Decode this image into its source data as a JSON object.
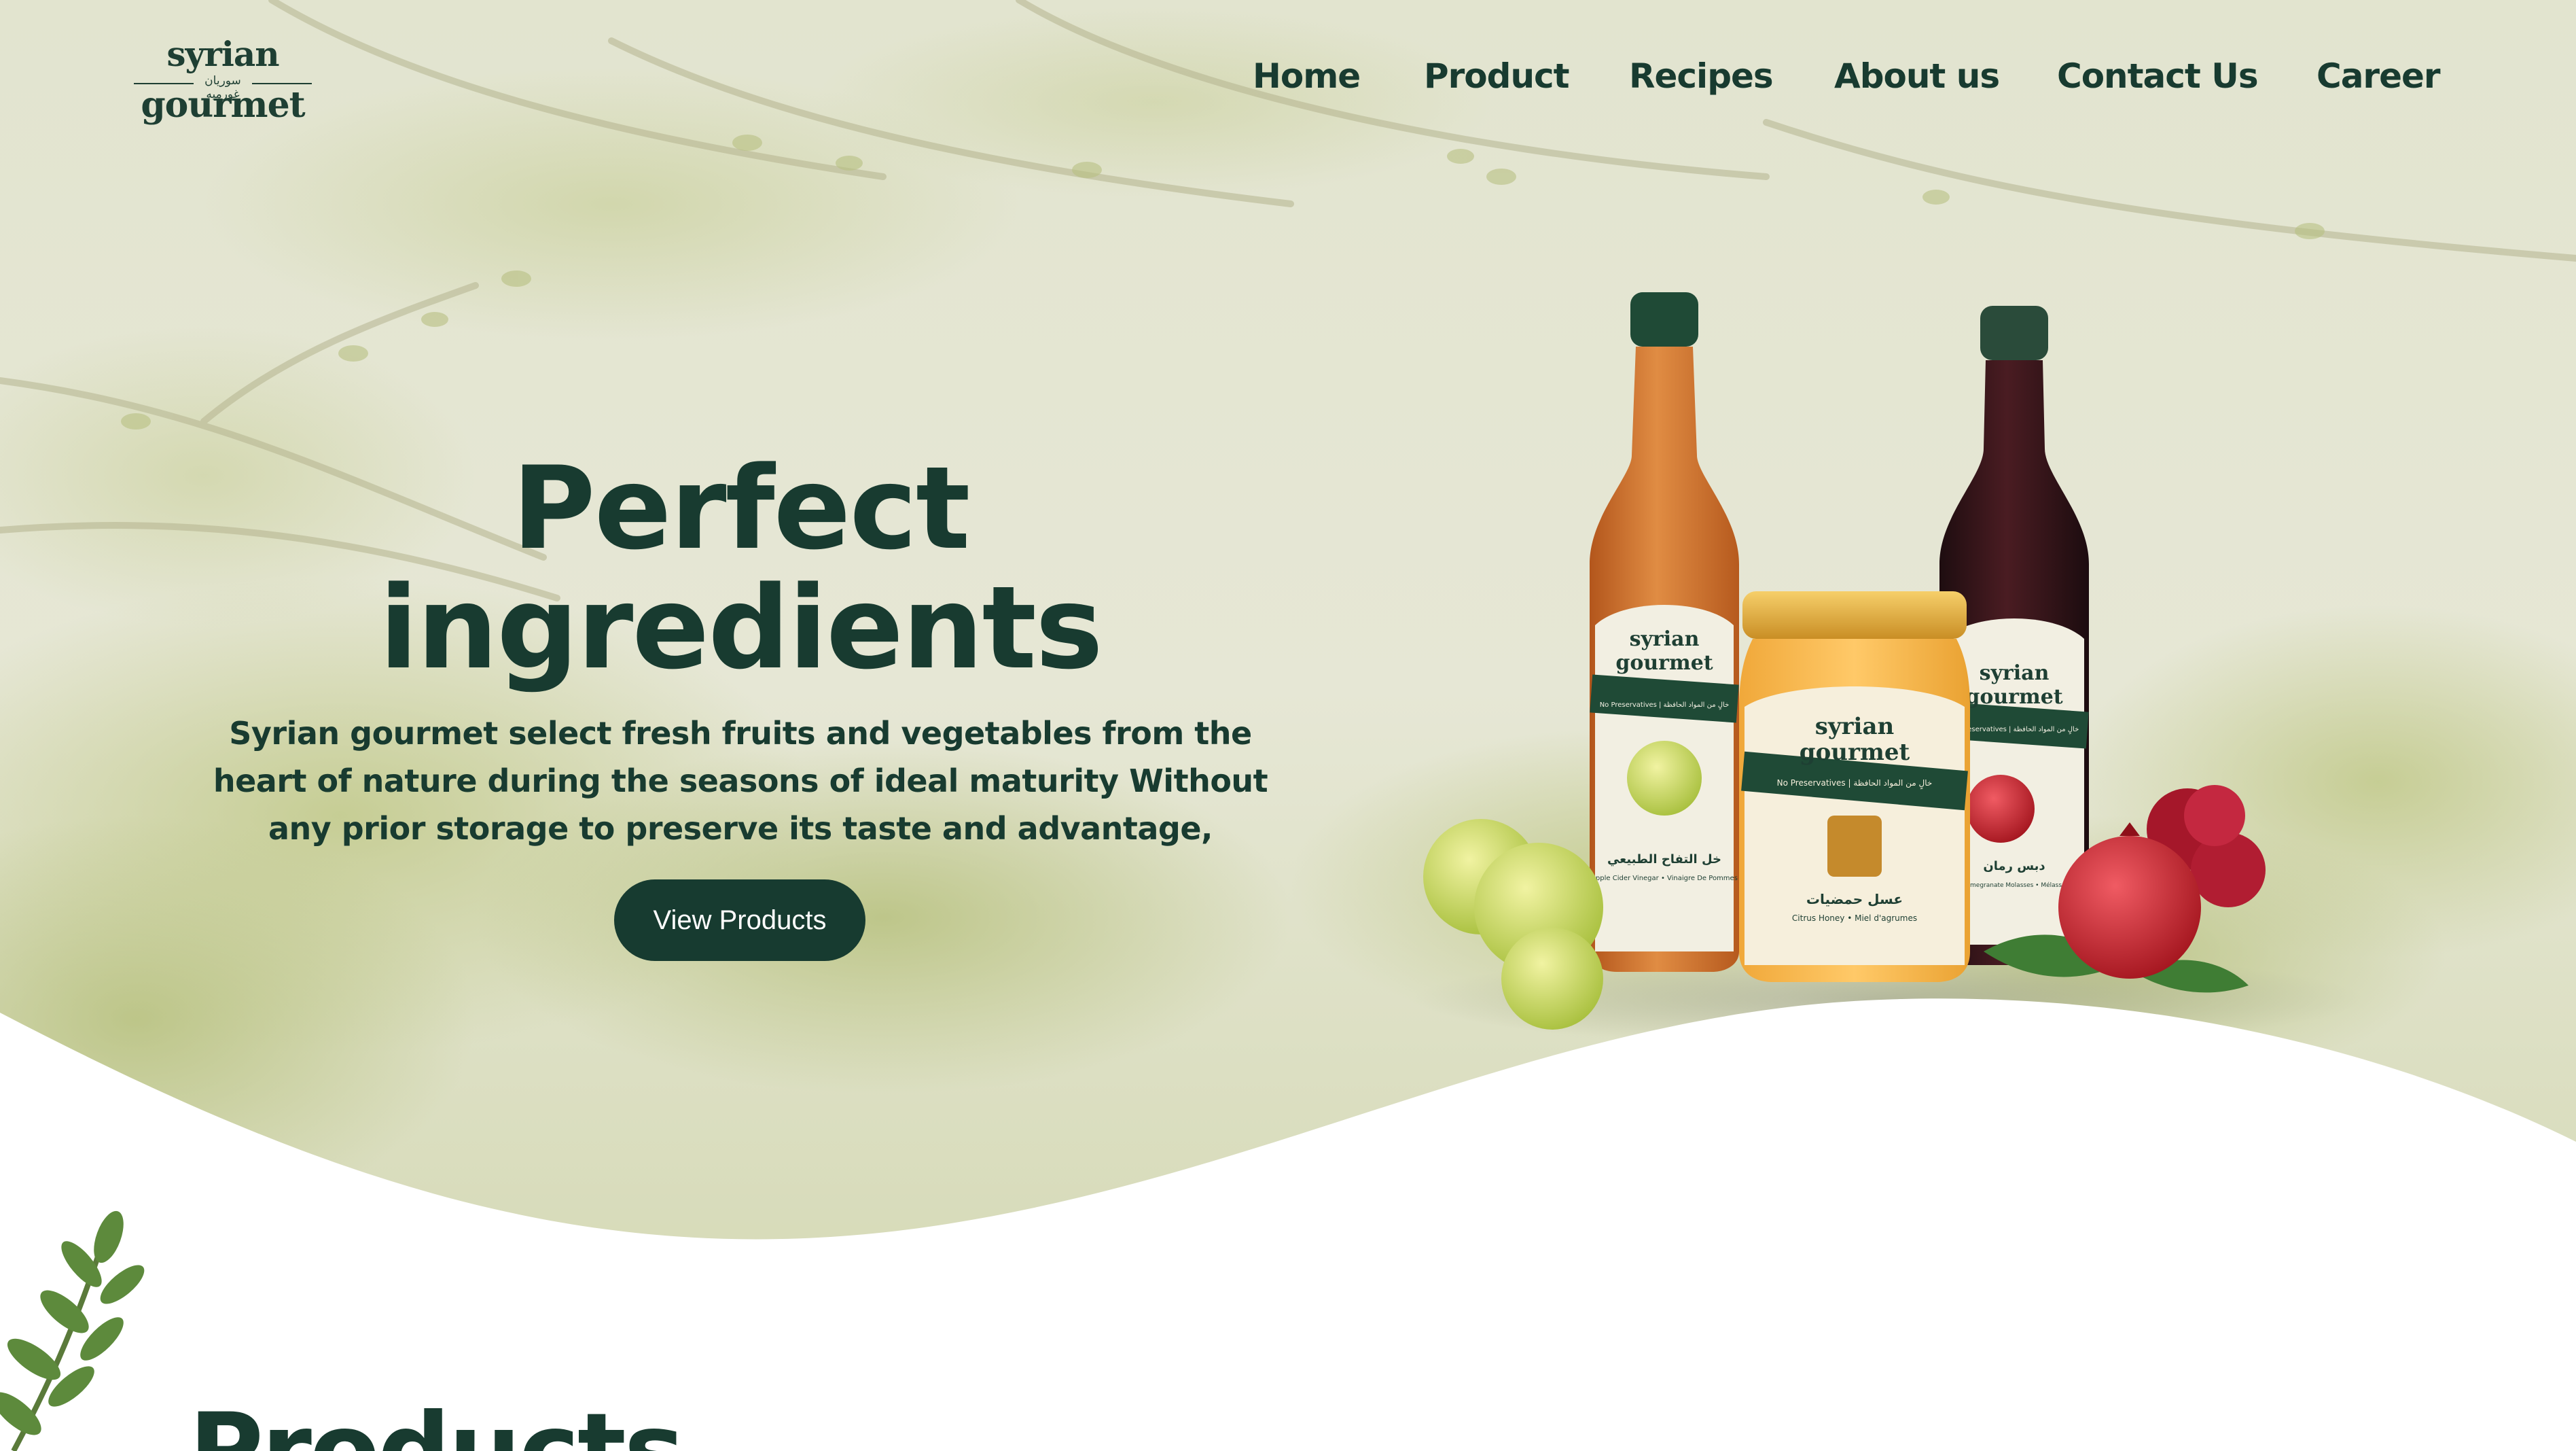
{
  "brand": {
    "logo_line1": "syrian",
    "logo_arabic": "سوريان غورميه",
    "logo_line2": "gourmet"
  },
  "nav": {
    "items": [
      "Home",
      "Product",
      "Recipes",
      "About us",
      "Contact Us",
      "Career"
    ]
  },
  "hero": {
    "headline_line1": "Perfect",
    "headline_line2": "ingredients",
    "description": "Syrian gourmet select fresh fruits and vegetables from the heart of nature during the seasons of ideal maturity Without any prior storage to preserve its taste and advantage,",
    "cta_label": "View Products"
  },
  "products_section": {
    "heading": "Products"
  },
  "product_images": {
    "vinegar": {
      "brand_top": "syrian",
      "brand_bottom": "gourmet",
      "ribbon": "No Preservatives | خالٍ من المواد الحافظة",
      "name_ar": "خل التفاح الطبيعي",
      "name_en": "Apple Cider Vinegar • Vinaigre De Pommes"
    },
    "honey": {
      "brand_top": "syrian",
      "brand_bottom": "gourmet",
      "ribbon": "No Preservatives | خالٍ من المواد الحافظة",
      "name_ar": "عسل حمضيات",
      "name_en": "Citrus Honey • Miel d'agrumes"
    },
    "molasses": {
      "brand_top": "syrian",
      "brand_bottom": "gourmet",
      "ribbon": "No Preservatives | خالٍ من المواد الحافظة",
      "name_ar": "دبس رمان",
      "name_en": "Pomegranate Molasses • Mélasse"
    }
  },
  "colors": {
    "brand_dark": "#183b30",
    "button_bg": "#173b30",
    "hero_bg": "#e4e6d3",
    "page_bg": "#ffffff"
  }
}
